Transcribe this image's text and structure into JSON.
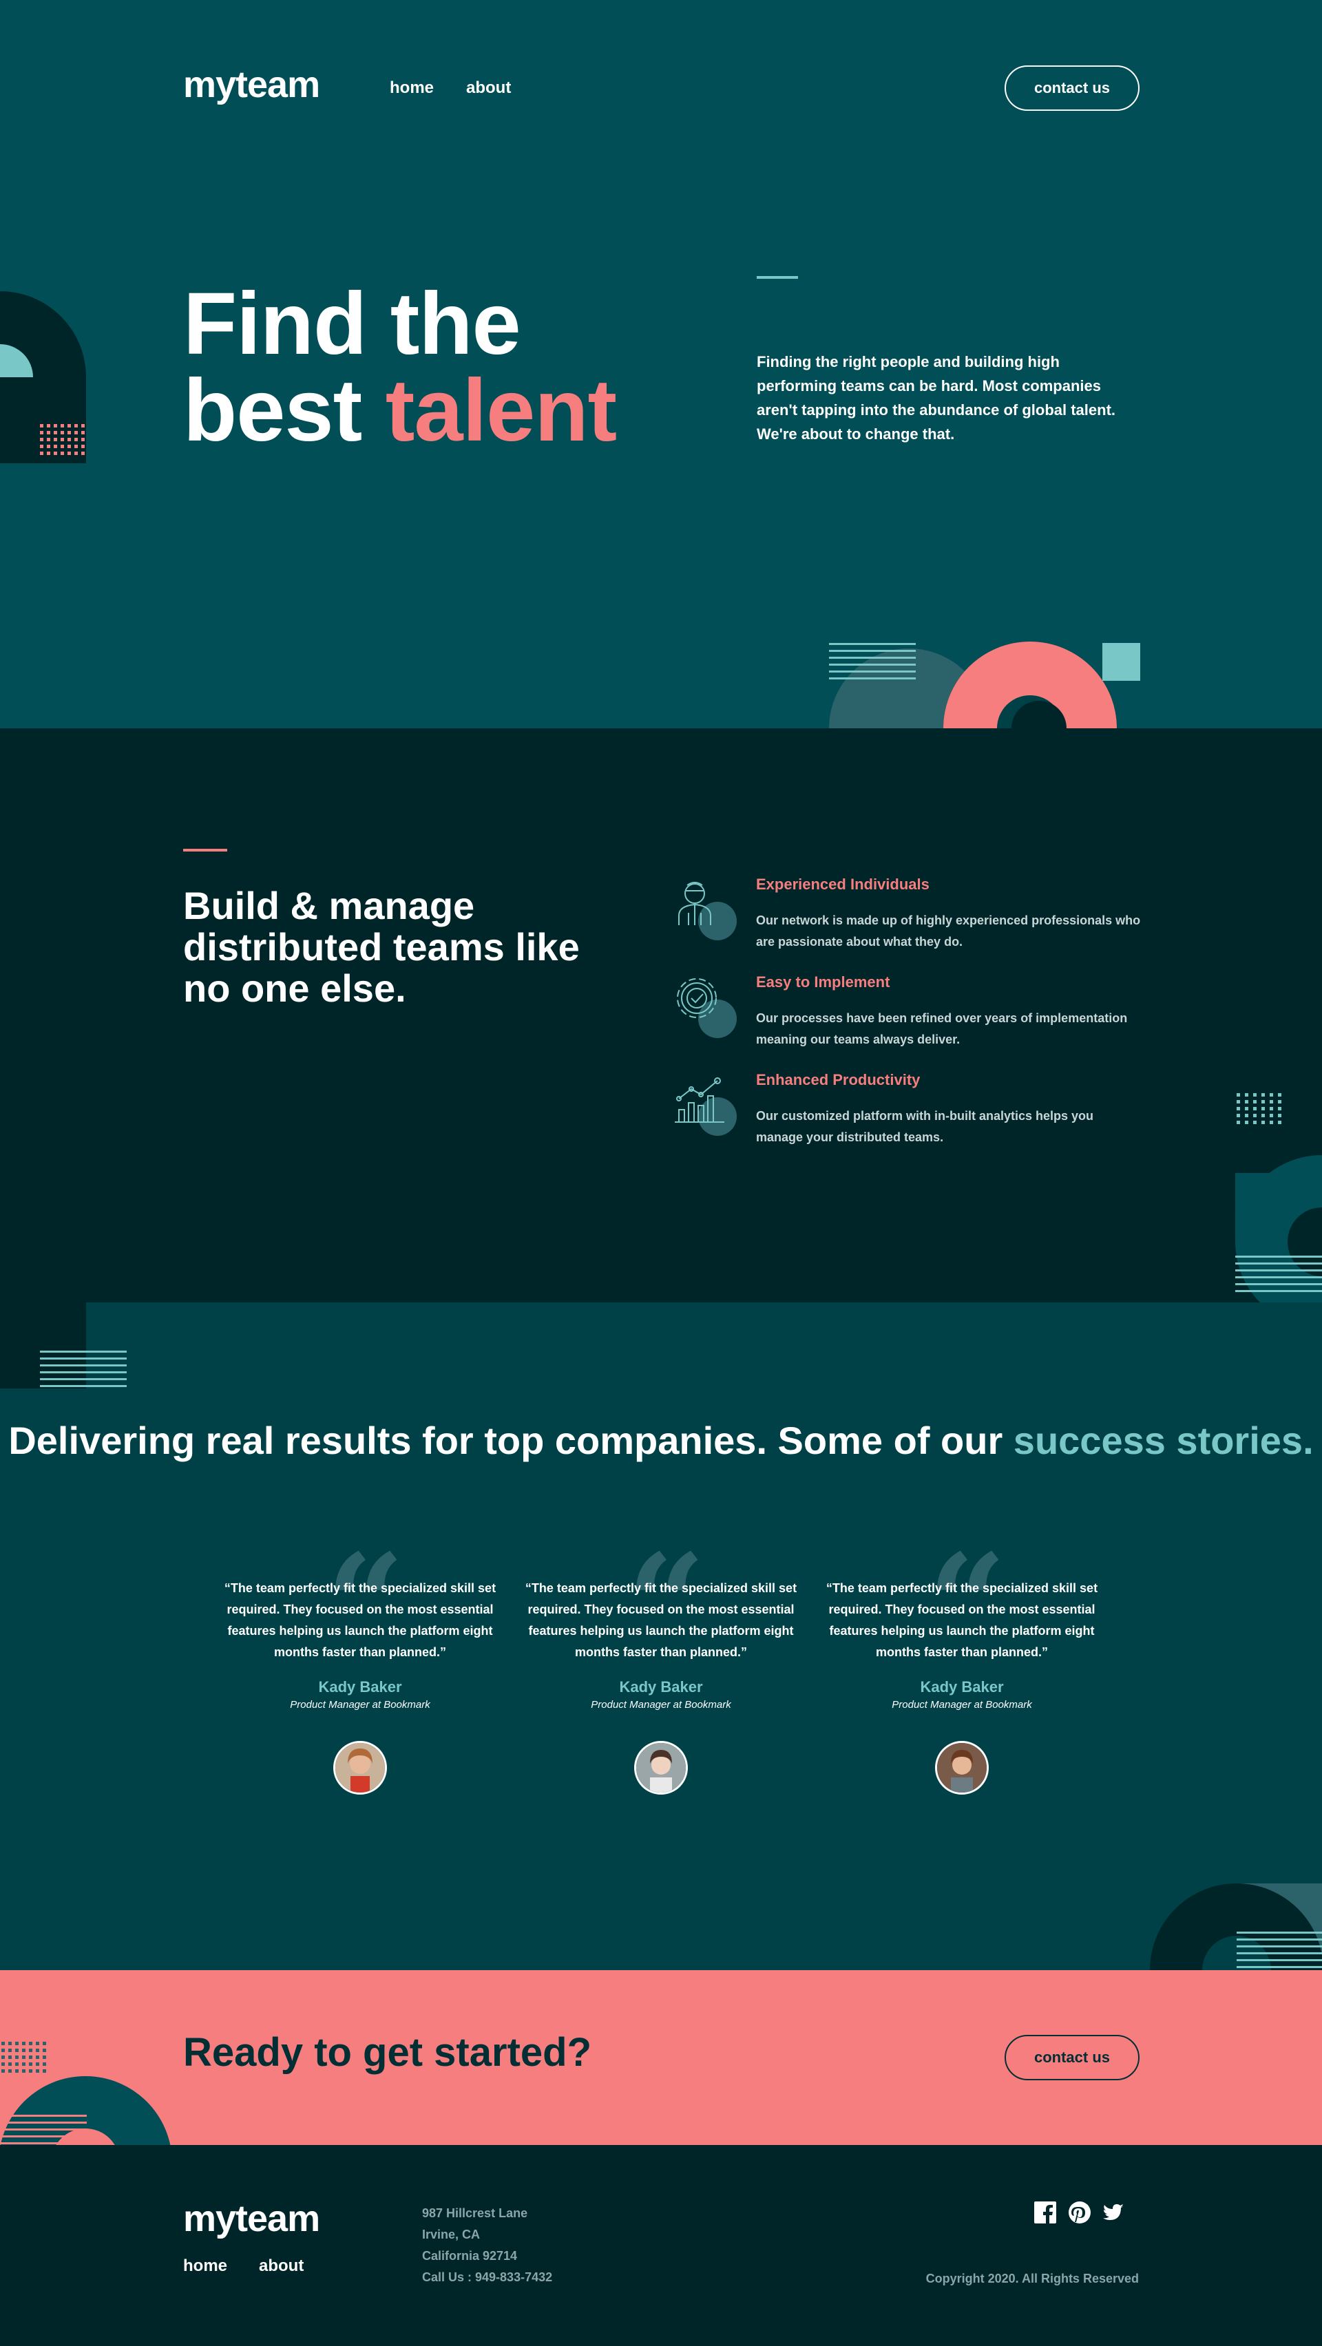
{
  "brand": {
    "logo": "myteam"
  },
  "nav": {
    "home": "home",
    "about": "about",
    "contact": "contact us"
  },
  "hero": {
    "title_line1": "Find the",
    "title_line2_plain": "best ",
    "title_line2_accent": "talent",
    "description": "Finding the right people and building high performing teams can be hard. Most companies aren't tapping into the abundance of global talent. We're about to change that."
  },
  "features": {
    "title": "Build & manage distributed teams like no one else.",
    "items": [
      {
        "name": "Experienced Individuals",
        "desc": "Our network is made up of highly experienced professionals who are passionate about what they do.",
        "icon": "person-icon"
      },
      {
        "name": "Easy to Implement",
        "desc": "Our processes have been refined over years of implementation meaning our teams always deliver.",
        "icon": "gear-check-icon"
      },
      {
        "name": "Enhanced Productivity",
        "desc": "Our customized platform with in-built analytics helps you manage your distributed teams.",
        "icon": "chart-icon"
      }
    ]
  },
  "testimonials": {
    "title_plain": "Delivering real results for top companies. Some of our ",
    "title_accent": "success stories.",
    "items": [
      {
        "quote": "“The team perfectly fit the specialized skill set required. They focused on the most essential features helping us launch the platform eight months faster than planned.”",
        "name": "Kady Baker",
        "role": "Product Manager at Bookmark"
      },
      {
        "quote": "“The team perfectly fit the specialized skill set required. They focused on the most essential features helping us launch the platform eight months faster than planned.”",
        "name": "Kady Baker",
        "role": "Product Manager at Bookmark"
      },
      {
        "quote": "“The team perfectly fit the specialized skill set required. They focused on the most essential features helping us launch the platform eight months faster than planned.”",
        "name": "Kady Baker",
        "role": "Product Manager at Bookmark"
      }
    ]
  },
  "cta": {
    "title": "Ready to get started?",
    "button": "contact us"
  },
  "footer": {
    "address": [
      "987 Hillcrest Lane",
      "Irvine, CA",
      "California 92714",
      "Call Us : 949-833-7432"
    ],
    "copyright": "Copyright 2020. All Rights Reserved",
    "social": [
      "facebook-icon",
      "pinterest-icon",
      "twitter-icon"
    ]
  },
  "colors": {
    "dark_teal": "#002529",
    "mid_teal": "#014e56",
    "teal": "#004047",
    "coral": "#f67e7e",
    "aqua": "#79c8c7"
  }
}
